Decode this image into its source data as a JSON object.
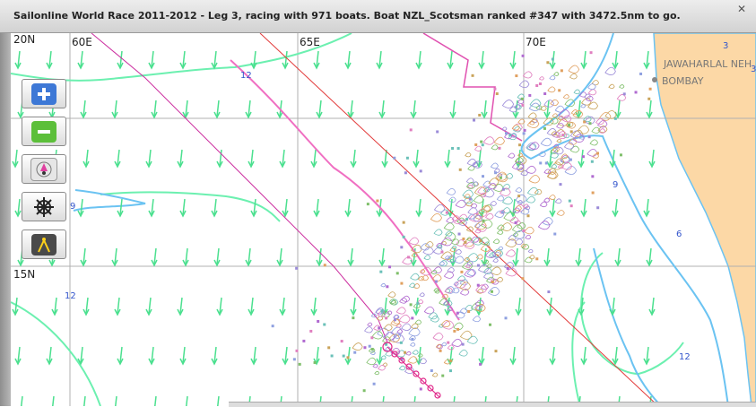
{
  "window": {
    "title": "Sailonline World Race 2011-2012 - Leg 3, racing with 971 boats. Boat NZL_Scotsman ranked #347 with 3472.5nm to go.",
    "close_glyph": "✕"
  },
  "map": {
    "lat_labels": [
      "20N",
      "15N"
    ],
    "lon_labels": [
      "60E",
      "65E",
      "70E"
    ],
    "city_label": "BOMBAY",
    "region_label": "JAWAHARLAL NEH",
    "depth_labels": [
      "12",
      "9",
      "12",
      "9",
      "6",
      "12",
      "3",
      "3"
    ],
    "colors": {
      "land": "#fcd8a6",
      "coast": "#6bc3f2",
      "wind_arrow": "#4be08f",
      "isobar": "#6cf0b0",
      "grid": "#b0b0b0",
      "rhumb_line": "#e23a3a",
      "route": "#e050b0",
      "own_boat": "#e0288a"
    }
  },
  "tools": [
    {
      "name": "zoom-in-button",
      "icon": "plus-icon"
    },
    {
      "name": "zoom-out-button",
      "icon": "minus-icon"
    },
    {
      "name": "center-boat-button",
      "icon": "boat-locate-icon"
    },
    {
      "name": "helm-button",
      "icon": "ship-wheel-icon"
    },
    {
      "name": "measure-button",
      "icon": "compass-divider-icon"
    }
  ]
}
